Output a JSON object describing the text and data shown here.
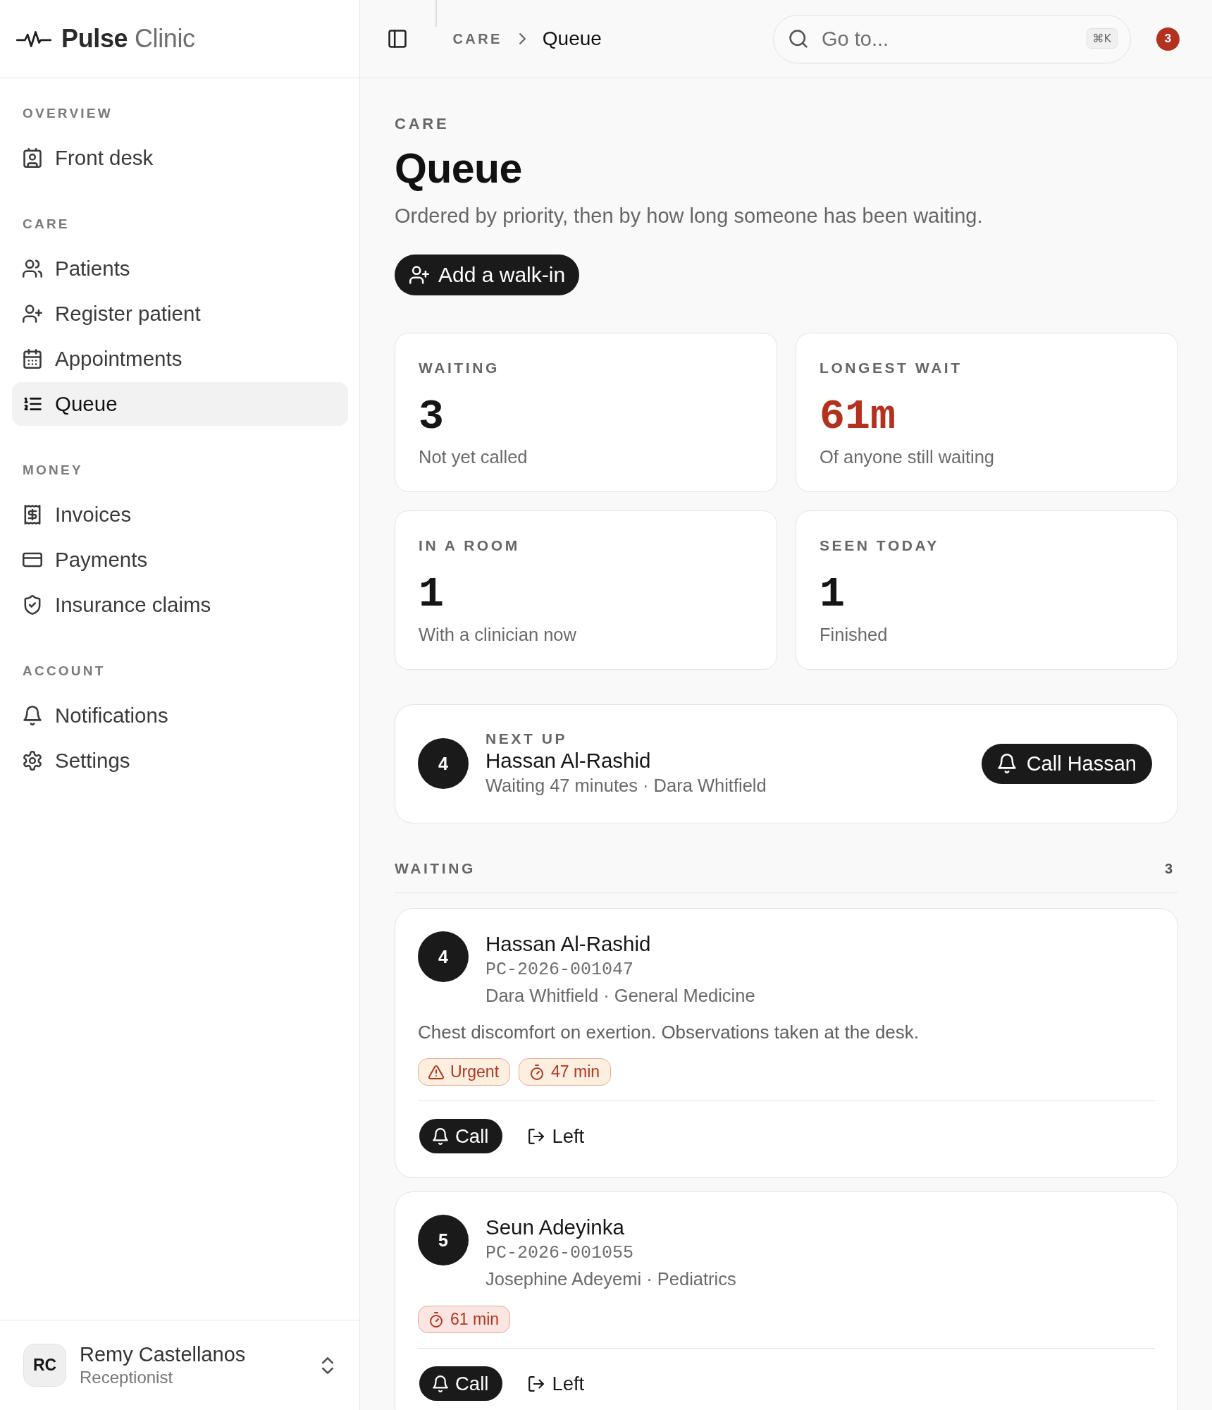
{
  "brand": {
    "name": "Pulse",
    "suffix": "Clinic"
  },
  "topbar": {
    "breadcrumb": [
      {
        "label": "CARE",
        "current": false
      },
      {
        "label": "Queue",
        "current": true
      }
    ],
    "search": {
      "placeholder": "Go to...",
      "shortcut": "⌘K"
    },
    "notification_count": "3"
  },
  "sidebar": {
    "sections": [
      {
        "title": "OVERVIEW",
        "items": [
          {
            "label": "Front desk",
            "selected": false
          }
        ]
      },
      {
        "title": "CARE",
        "items": [
          {
            "label": "Patients",
            "selected": false
          },
          {
            "label": "Register patient",
            "selected": false
          },
          {
            "label": "Appointments",
            "selected": false
          },
          {
            "label": "Queue",
            "selected": true
          }
        ]
      },
      {
        "title": "MONEY",
        "items": [
          {
            "label": "Invoices",
            "selected": false
          },
          {
            "label": "Payments",
            "selected": false
          },
          {
            "label": "Insurance claims",
            "selected": false
          }
        ]
      },
      {
        "title": "ACCOUNT",
        "items": [
          {
            "label": "Notifications",
            "selected": false
          },
          {
            "label": "Settings",
            "selected": false
          }
        ]
      }
    ],
    "user": {
      "initials": "RC",
      "name": "Remy Castellanos",
      "role": "Receptionist"
    }
  },
  "page": {
    "eyebrow": "CARE",
    "title": "Queue",
    "subtitle": "Ordered by priority, then by how long someone has been waiting.",
    "action": "Add a walk-in"
  },
  "stats": [
    {
      "label": "WAITING",
      "value": "3",
      "caption": "Not yet called",
      "alert": false
    },
    {
      "label": "LONGEST WAIT",
      "value": "61m",
      "caption": "Of anyone still waiting",
      "alert": true
    },
    {
      "label": "IN A ROOM",
      "value": "1",
      "caption": "With a clinician now",
      "alert": false
    },
    {
      "label": "SEEN TODAY",
      "value": "1",
      "caption": "Finished",
      "alert": false
    }
  ],
  "next_up": {
    "label": "NEXT UP",
    "number": "4",
    "name": "Hassan Al-Rashid",
    "detail": "Waiting 47 minutes · Dara Whitfield",
    "action": "Call Hassan"
  },
  "waiting": {
    "title": "WAITING",
    "count": "3",
    "entries": [
      {
        "number": "4",
        "name": "Hassan Al-Rashid",
        "patient_id": "PC-2026-001047",
        "meta": "Dara Whitfield · General Medicine",
        "note": "Chest discomfort on exertion. Observations taken at the desk.",
        "tags": [
          {
            "kind": "priority",
            "label": "Urgent",
            "color": "#fcefe0"
          },
          {
            "kind": "wait",
            "label": "47 min",
            "color": "#fcefe0"
          }
        ],
        "actions": [
          {
            "kind": "call",
            "label": "Call"
          },
          {
            "kind": "left",
            "label": "Left"
          }
        ]
      },
      {
        "number": "5",
        "name": "Seun Adeyinka",
        "patient_id": "PC-2026-001055",
        "meta": "Josephine Adeyemi · Pediatrics",
        "tags": [
          {
            "kind": "wait",
            "label": "61 min",
            "color": "#fbe5e2"
          }
        ],
        "actions": [
          {
            "kind": "call",
            "label": "Call"
          },
          {
            "kind": "left",
            "label": "Left"
          }
        ]
      }
    ]
  }
}
